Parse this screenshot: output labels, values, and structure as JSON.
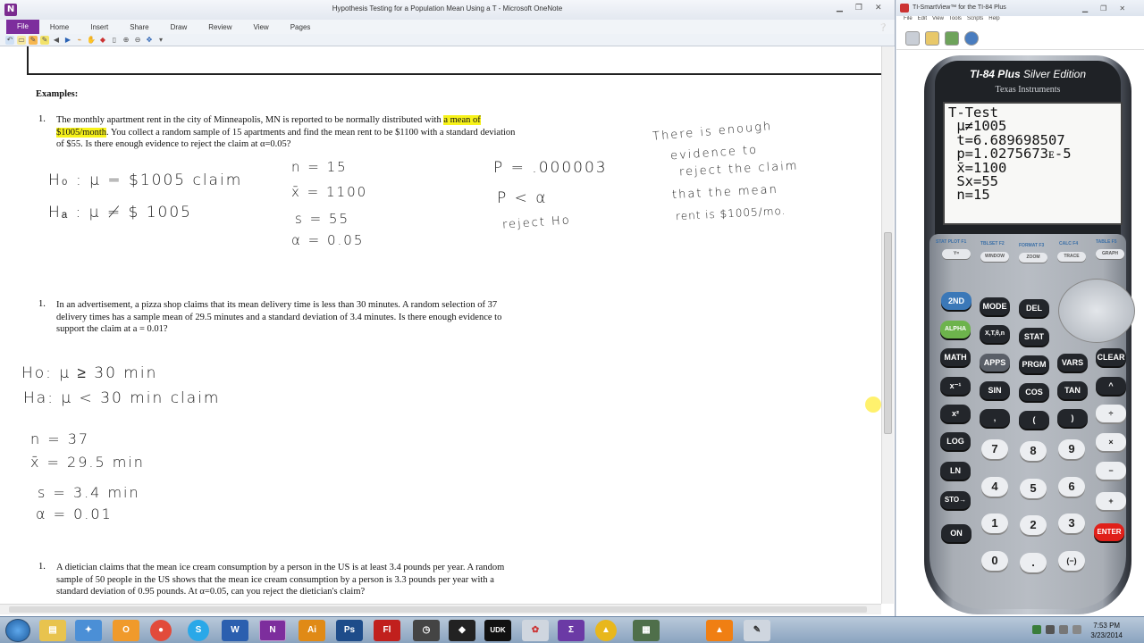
{
  "onenote": {
    "window_title": "Hypothesis Testing for a Population Mean Using a T  -  Microsoft OneNote",
    "app_letter": "N",
    "ribbon_tabs": [
      "File",
      "Home",
      "Insert",
      "Share",
      "Draw",
      "Review",
      "View",
      "Pages"
    ],
    "examples_heading": "Examples:",
    "problems": [
      {
        "number": "1.",
        "text_parts": [
          "The monthly apartment rent in the city of Minneapolis,  MN is reported to be normally  distributed with ",
          "a mean of $1005/month",
          ".  You collect a random sample of 15 apartments and find the mean rent to be $1100 with a standard deviation of $55.  Is there enough evidence to reject the claim at  α=0.05?"
        ]
      },
      {
        "number": "1.",
        "text": "In an advertisement, a pizza shop claims that its mean delivery time is less than 30 minutes.  A random selection of 37 delivery times has a sample mean of 29.5 minutes  and a standard deviation  of 3.4 minutes.  Is there enough evidence to support the claim  at a = 0.01?"
      },
      {
        "number": "1.",
        "text": "A dietician claims that the mean ice cream consumption by a person in the US is at least 3.4 pounds per year.  A random sample of 50 people in the US shows that the mean ice cream consumption by a person is 3.3 pounds per year with a standard deviation of 0.95 pounds.  At α=0.05, can you reject the dietician's claim?"
      }
    ],
    "handwriting": {
      "p1": {
        "h0": "H₀ : μ = $1005 claim",
        "ha": "Hₐ : μ ≠ $ 1005",
        "n": "n = 15",
        "xbar": "x̄ = 1100",
        "s": "s = 55",
        "alpha": "α = 0.05",
        "p": "P = .000003",
        "p_lt_a": "P < α",
        "reject": "reject Ho",
        "conclusion": [
          "There is enough",
          "evidence to",
          "reject the claim",
          "that the mean",
          "rent is $1005/mo."
        ]
      },
      "p2": {
        "h0": "Ho:  μ ≥ 30  min",
        "ha": "Ha:  μ < 30  min   claim",
        "n": "n = 37",
        "xbar": "x̄ =  29.5 min",
        "s": "s = 3.4  min",
        "alpha": "α = 0.01"
      }
    }
  },
  "ti": {
    "window_title": "TI-SmartView™ for the TI-84 Plus",
    "menu": [
      "File",
      "Edit",
      "View",
      "Tools",
      "Scripts",
      "Help"
    ],
    "brand": "TI-84 Plus",
    "brand_suffix": "Silver Edition",
    "maker": "Texas Instruments",
    "screen": "T-Test\n μ≠1005\n t=6.689698507\n p=1.0275673ᴇ-5\n x̄=1100\n Sx=55\n n=15",
    "fn_keys": [
      "Y=",
      "WINDOW",
      "ZOOM",
      "TRACE",
      "GRAPH"
    ],
    "fn_labels": [
      "STAT PLOT F1",
      "TBLSET F2",
      "FORMAT F3",
      "CALC F4",
      "TABLE F5"
    ],
    "keys": {
      "second": "2ND",
      "mode": "MODE",
      "del": "DEL",
      "alpha": "ALPHA",
      "xt": "X,T,θ,n",
      "stat": "STAT",
      "math": "MATH",
      "apps": "APPS",
      "prgm": "PRGM",
      "vars": "VARS",
      "clear": "CLEAR",
      "xinv": "x⁻¹",
      "sin": "SIN",
      "cos": "COS",
      "tan": "TAN",
      "pow": "^",
      "sq": "x²",
      "comma": ",",
      "lpar": "(",
      "rpar": ")",
      "div": "÷",
      "log": "LOG",
      "mul": "×",
      "ln": "LN",
      "sub": "−",
      "sto": "STO→",
      "add": "+",
      "on": "ON",
      "neg": "(−)",
      "enter": "ENTER",
      "dot": ".",
      "n7": "7",
      "n8": "8",
      "n9": "9",
      "n4": "4",
      "n5": "5",
      "n6": "6",
      "n1": "1",
      "n2": "2",
      "n3": "3",
      "n0": "0"
    }
  },
  "taskbar": {
    "time": "7:53 PM",
    "date": "3/23/2014",
    "apps": [
      "Windows Explorer",
      "Windows Media Player",
      "Outlook",
      "Chrome",
      "Skype",
      "Word",
      "OneNote",
      "Illustrator",
      "Photoshop",
      "Flash",
      "App",
      "Steam",
      "UDK",
      "Paint",
      "Visual Studio",
      "Navigator",
      "App",
      "VLC",
      "Pen"
    ]
  }
}
